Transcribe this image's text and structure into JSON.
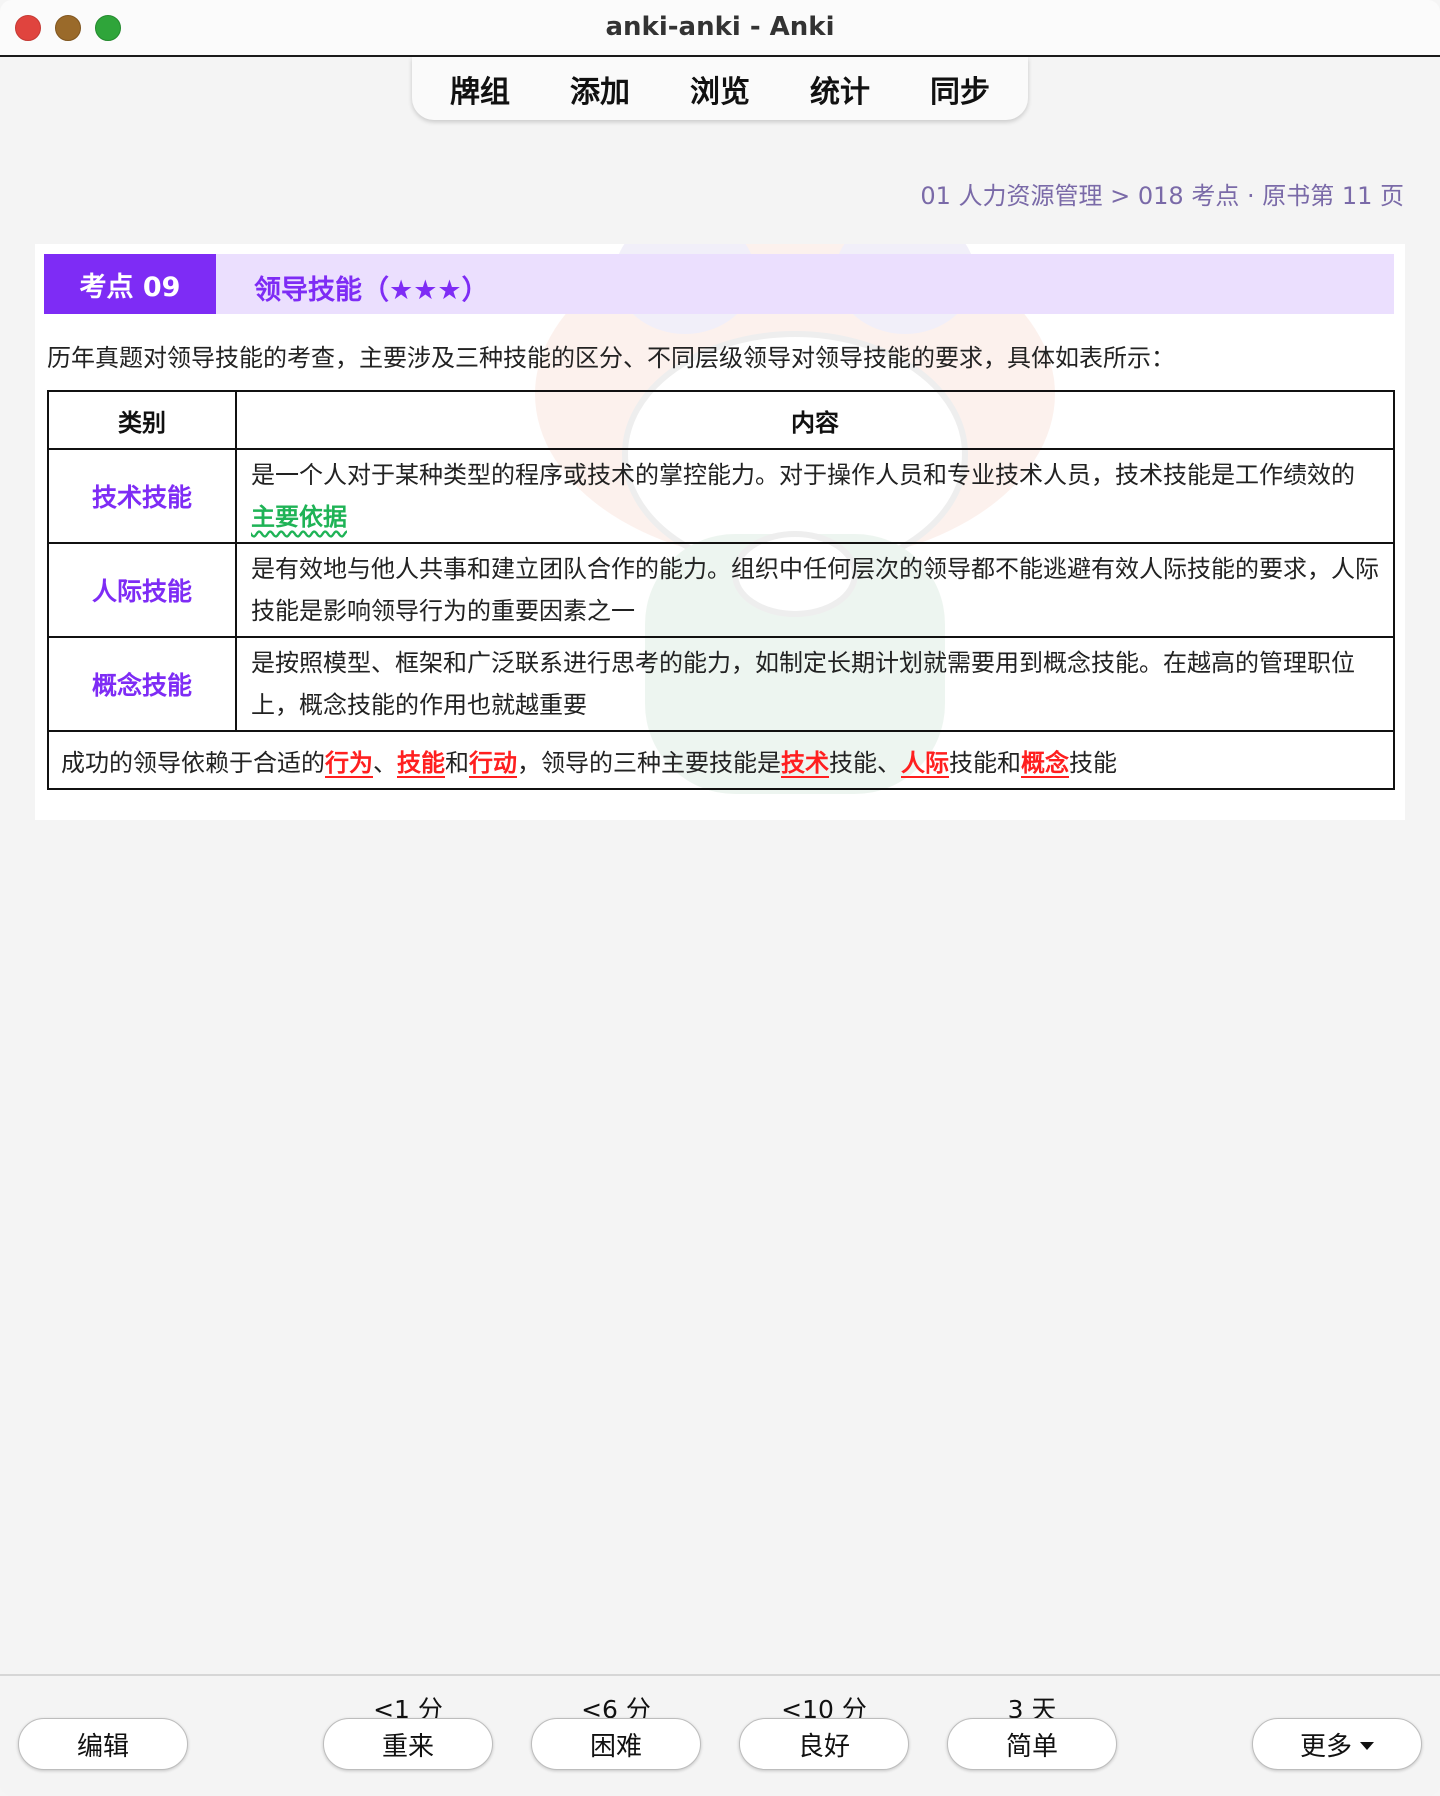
{
  "window": {
    "title": "anki-anki - Anki"
  },
  "nav": {
    "items": [
      "牌组",
      "添加",
      "浏览",
      "统计",
      "同步"
    ]
  },
  "breadcrumb": "01 人力资源管理 > 018 考点 · 原书第 11 页",
  "card": {
    "badge": "考点 09",
    "title": "领导技能（★★★）",
    "intro": "历年真题对领导技能的考查，主要涉及三种技能的区分、不同层级领导对领导技能的要求，具体如表所示：",
    "table": {
      "headers": [
        "类别",
        "内容"
      ],
      "rows": [
        {
          "category": "技术技能",
          "text": "是一个人对于某种类型的程序或技术的掌控能力。对于操作人员和专业技术人员，技术技能是工作绩效的",
          "highlight": "主要依据"
        },
        {
          "category": "人际技能",
          "text": "是有效地与他人共事和建立团队合作的能力。组织中任何层次的领导都不能逃避有效人际技能的要求，人际技能是影响领导行为的重要因素之一"
        },
        {
          "category": "概念技能",
          "text": "是按照模型、框架和广泛联系进行思考的能力，如制定长期计划就需要用到概念技能。在越高的管理职位上，概念技能的作用也就越重要"
        }
      ],
      "summary": {
        "s1": "成功的领导依赖于合适的",
        "k1": "行为",
        "s2": "、",
        "k2": "技能",
        "s3": "和",
        "k3": "行动",
        "s4": "，领导的三种主要技能是",
        "k4": "技术",
        "s5": "技能、",
        "k5": "人际",
        "s6": "技能和",
        "k6": "概念",
        "s7": "技能"
      }
    }
  },
  "answer": {
    "edit_label": "编辑",
    "more_label": "更多",
    "buttons": [
      {
        "label": "重来",
        "interval": "<1 分"
      },
      {
        "label": "困难",
        "interval": "<6 分"
      },
      {
        "label": "良好",
        "interval": "<10 分"
      },
      {
        "label": "简单",
        "interval": "3 天"
      }
    ]
  },
  "colors": {
    "accent": "#7e2cf5",
    "header_bg": "#ebdffe",
    "highlight_green": "#1fb356",
    "highlight_red": "#ff1f1f",
    "breadcrumb": "#7a6aa8"
  }
}
